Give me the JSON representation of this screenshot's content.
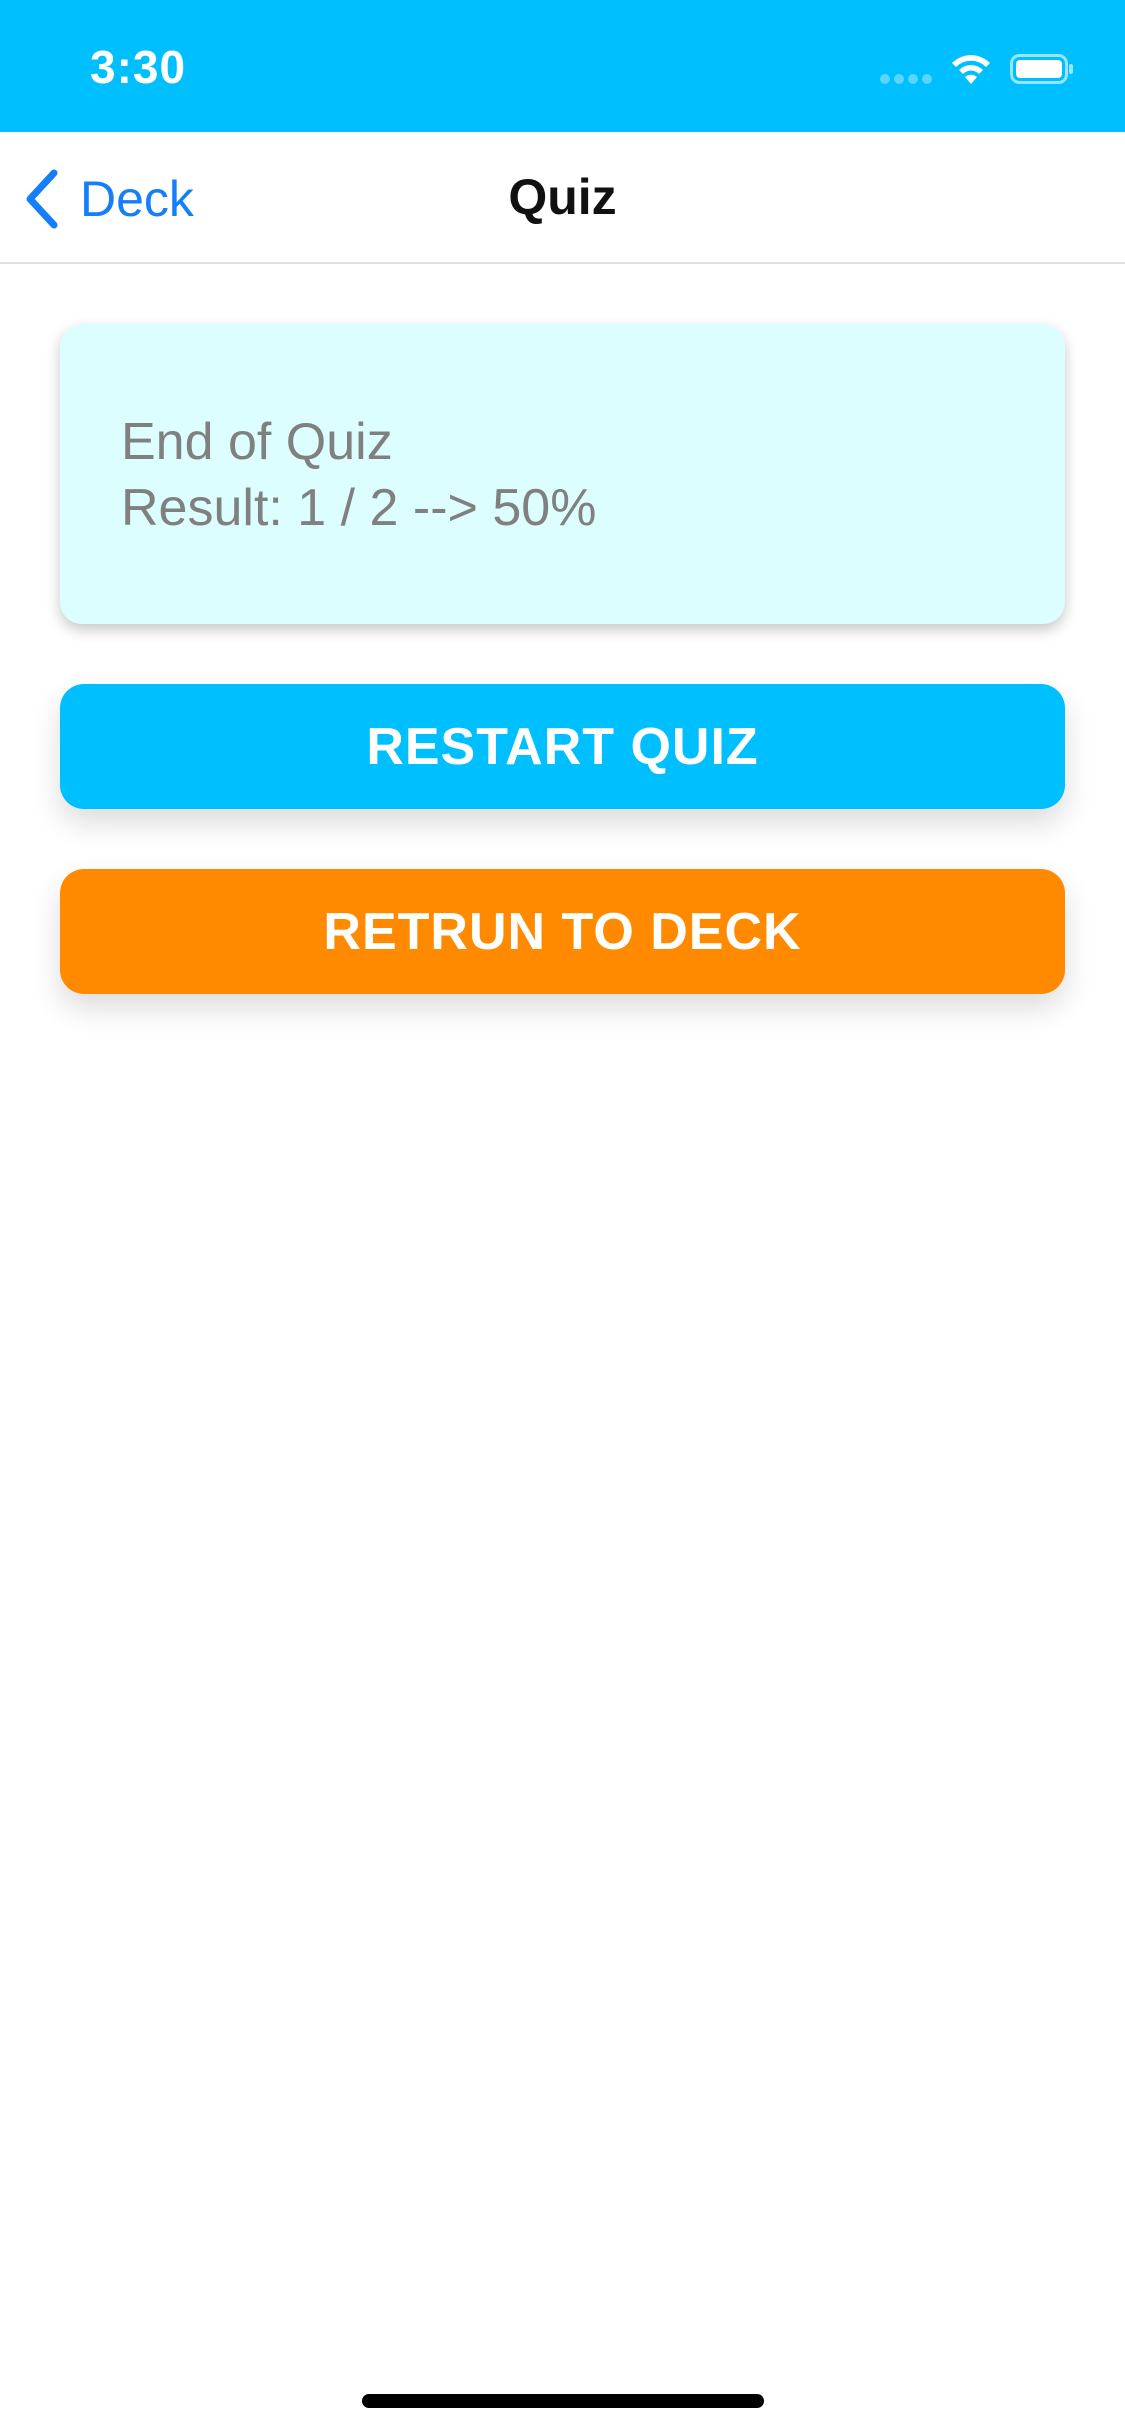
{
  "status_bar": {
    "time": "3:30",
    "background_color": "#00bfff",
    "icons": [
      "cellular-signal-icon",
      "wifi-icon",
      "battery-icon"
    ]
  },
  "nav": {
    "back_label": "Deck",
    "back_icon": "chevron-left-icon",
    "title": "Quiz",
    "accent_color": "#147efb"
  },
  "result": {
    "line1": "End of Quiz",
    "line2": "Result: 1 / 2 --> 50%",
    "card_color": "#dcfeff"
  },
  "buttons": {
    "restart_label": "RESTART QUIZ",
    "restart_color": "#00bfff",
    "return_label": "RETRUN TO DECK",
    "return_color": "#ff8a00"
  }
}
